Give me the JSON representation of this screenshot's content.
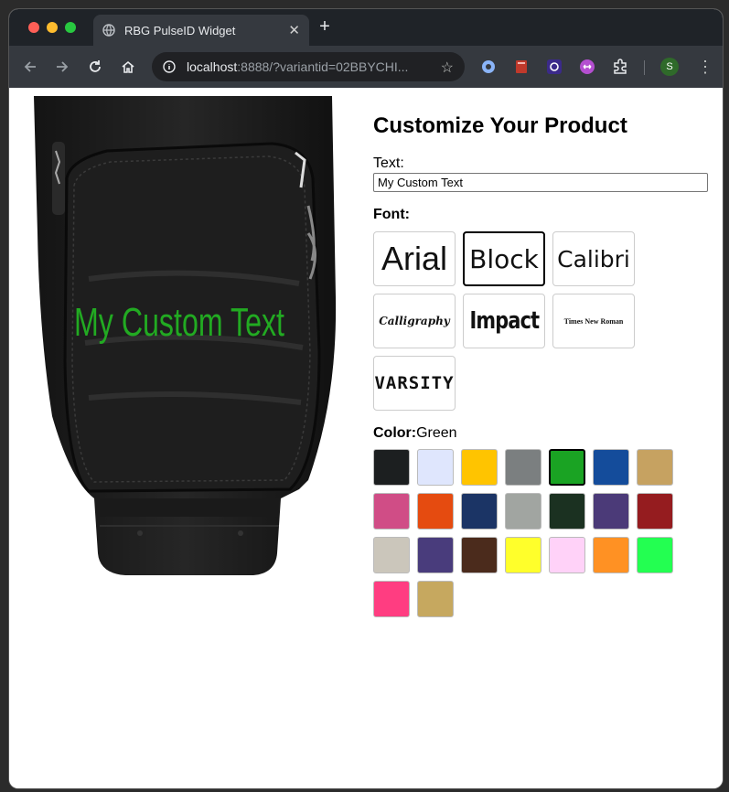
{
  "browser": {
    "tab_title": "RBG PulseID Widget",
    "url_host": "localhost",
    "url_rest": ":8888/?variantid=02BBYCHI...",
    "profile_initial": "S"
  },
  "page": {
    "heading": "Customize Your Product",
    "text_label": "Text:",
    "text_value": "My Custom Text",
    "font_label": "Font:",
    "color_label": "Color:",
    "color_selected_name": "Green",
    "preview_text": "My Custom Text",
    "preview_text_color": "#22aa22"
  },
  "fonts": [
    {
      "label": "Arial",
      "selected": false
    },
    {
      "label": "Block",
      "selected": true
    },
    {
      "label": "Calibri",
      "selected": false
    },
    {
      "label": "Calligraphy",
      "selected": false
    },
    {
      "label": "Impact",
      "selected": false
    },
    {
      "label": "Times New Roman",
      "selected": false
    },
    {
      "label": "VARSITY",
      "selected": false
    }
  ],
  "colors": [
    {
      "hex": "#1c1f20",
      "selected": false
    },
    {
      "hex": "#dfe6fd",
      "selected": false
    },
    {
      "hex": "#ffc400",
      "selected": false
    },
    {
      "hex": "#7b7f80",
      "selected": false
    },
    {
      "hex": "#1aa323",
      "selected": true
    },
    {
      "hex": "#144c9b",
      "selected": false
    },
    {
      "hex": "#c6a261",
      "selected": false
    },
    {
      "hex": "#d04d86",
      "selected": false
    },
    {
      "hex": "#e54b10",
      "selected": false
    },
    {
      "hex": "#1b3465",
      "selected": false
    },
    {
      "hex": "#a1a5a1",
      "selected": false
    },
    {
      "hex": "#1b3121",
      "selected": false
    },
    {
      "hex": "#4b3a78",
      "selected": false
    },
    {
      "hex": "#951c1f",
      "selected": false
    },
    {
      "hex": "#cbc6bb",
      "selected": false
    },
    {
      "hex": "#493c7c",
      "selected": false
    },
    {
      "hex": "#4b2b1c",
      "selected": false
    },
    {
      "hex": "#ffff2b",
      "selected": false
    },
    {
      "hex": "#ffd2f8",
      "selected": false
    },
    {
      "hex": "#ff9123",
      "selected": false
    },
    {
      "hex": "#23ff51",
      "selected": false
    },
    {
      "hex": "#ff3d81",
      "selected": false
    },
    {
      "hex": "#c6a85f",
      "selected": false
    }
  ]
}
